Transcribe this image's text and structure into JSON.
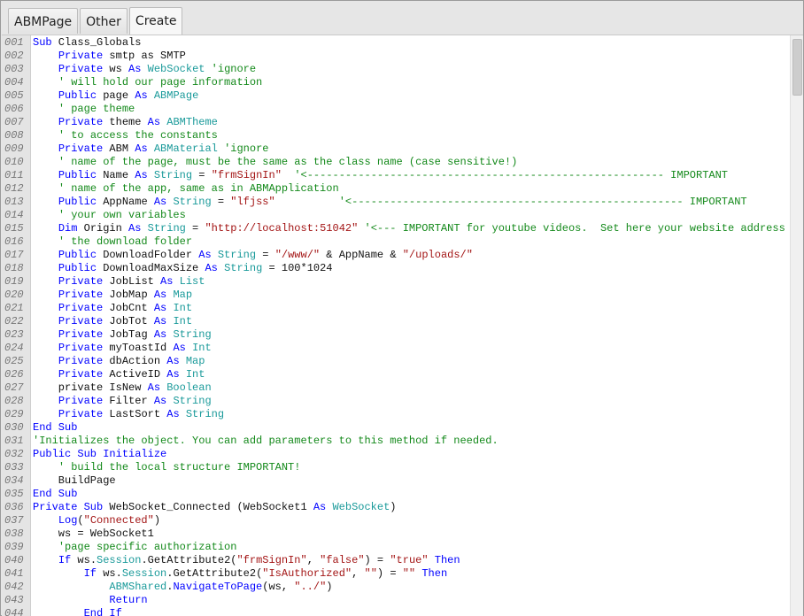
{
  "tabs": [
    {
      "label": "ABMPage"
    },
    {
      "label": "Other"
    },
    {
      "label": "Create",
      "active": true
    }
  ],
  "colors": {
    "keyword": "#0000ff",
    "type": "#1a9a9a",
    "string": "#a31515",
    "comment": "#13891a"
  },
  "lines": [
    [
      [
        "kw",
        "Sub"
      ],
      [
        "pl",
        " Class_Globals"
      ]
    ],
    [
      [
        "pl",
        "    "
      ],
      [
        "kw",
        "Private"
      ],
      [
        "pl",
        " smtp as SMTP"
      ]
    ],
    [
      [
        "pl",
        "    "
      ],
      [
        "kw",
        "Private"
      ],
      [
        "pl",
        " ws "
      ],
      [
        "kw",
        "As"
      ],
      [
        "pl",
        " "
      ],
      [
        "ty",
        "WebSocket"
      ],
      [
        "pl",
        " "
      ],
      [
        "cm",
        "'ignore"
      ]
    ],
    [
      [
        "pl",
        "    "
      ],
      [
        "cm",
        "' will hold our page information"
      ]
    ],
    [
      [
        "pl",
        "    "
      ],
      [
        "kw",
        "Public"
      ],
      [
        "pl",
        " page "
      ],
      [
        "kw",
        "As"
      ],
      [
        "pl",
        " "
      ],
      [
        "ty",
        "ABMPage"
      ]
    ],
    [
      [
        "pl",
        "    "
      ],
      [
        "cm",
        "' page theme"
      ]
    ],
    [
      [
        "pl",
        "    "
      ],
      [
        "kw",
        "Private"
      ],
      [
        "pl",
        " theme "
      ],
      [
        "kw",
        "As"
      ],
      [
        "pl",
        " "
      ],
      [
        "ty",
        "ABMTheme"
      ]
    ],
    [
      [
        "pl",
        "    "
      ],
      [
        "cm",
        "' to access the constants"
      ]
    ],
    [
      [
        "pl",
        "    "
      ],
      [
        "kw",
        "Private"
      ],
      [
        "pl",
        " ABM "
      ],
      [
        "kw",
        "As"
      ],
      [
        "pl",
        " "
      ],
      [
        "ty",
        "ABMaterial"
      ],
      [
        "pl",
        " "
      ],
      [
        "cm",
        "'ignore"
      ]
    ],
    [
      [
        "pl",
        "    "
      ],
      [
        "cm",
        "' name of the page, must be the same as the class name (case sensitive!)"
      ]
    ],
    [
      [
        "pl",
        "    "
      ],
      [
        "kw",
        "Public"
      ],
      [
        "pl",
        " Name "
      ],
      [
        "kw",
        "As"
      ],
      [
        "pl",
        " "
      ],
      [
        "ty",
        "String"
      ],
      [
        "pl",
        " = "
      ],
      [
        "st",
        "\"frmSignIn\""
      ],
      [
        "pl",
        "  "
      ],
      [
        "cm",
        "'<-------------------------------------------------------- IMPORTANT"
      ]
    ],
    [
      [
        "pl",
        "    "
      ],
      [
        "cm",
        "' name of the app, same as in ABMApplication"
      ]
    ],
    [
      [
        "pl",
        "    "
      ],
      [
        "kw",
        "Public"
      ],
      [
        "pl",
        " AppName "
      ],
      [
        "kw",
        "As"
      ],
      [
        "pl",
        " "
      ],
      [
        "ty",
        "String"
      ],
      [
        "pl",
        " = "
      ],
      [
        "st",
        "\"lfjss\""
      ],
      [
        "pl",
        "          "
      ],
      [
        "cm",
        "'<---------------------------------------------------- IMPORTANT"
      ]
    ],
    [
      [
        "pl",
        "    "
      ],
      [
        "cm",
        "' your own variables"
      ]
    ],
    [
      [
        "pl",
        "    "
      ],
      [
        "kw",
        "Dim"
      ],
      [
        "pl",
        " Origin "
      ],
      [
        "kw",
        "As"
      ],
      [
        "pl",
        " "
      ],
      [
        "ty",
        "String"
      ],
      [
        "pl",
        " = "
      ],
      [
        "st",
        "\"http://localhost:51042\""
      ],
      [
        "pl",
        " "
      ],
      [
        "cm",
        "'<--- IMPORTANT for youtube videos.  Set here your website address"
      ]
    ],
    [
      [
        "pl",
        "    "
      ],
      [
        "cm",
        "' the download folder"
      ]
    ],
    [
      [
        "pl",
        "    "
      ],
      [
        "kw",
        "Public"
      ],
      [
        "pl",
        " DownloadFolder "
      ],
      [
        "kw",
        "As"
      ],
      [
        "pl",
        " "
      ],
      [
        "ty",
        "String"
      ],
      [
        "pl",
        " = "
      ],
      [
        "st",
        "\"/www/\""
      ],
      [
        "pl",
        " & AppName & "
      ],
      [
        "st",
        "\"/uploads/\""
      ]
    ],
    [
      [
        "pl",
        "    "
      ],
      [
        "kw",
        "Public"
      ],
      [
        "pl",
        " DownloadMaxSize "
      ],
      [
        "kw",
        "As"
      ],
      [
        "pl",
        " "
      ],
      [
        "ty",
        "String"
      ],
      [
        "pl",
        " = 100*1024"
      ]
    ],
    [
      [
        "pl",
        "    "
      ],
      [
        "kw",
        "Private"
      ],
      [
        "pl",
        " JobList "
      ],
      [
        "kw",
        "As"
      ],
      [
        "pl",
        " "
      ],
      [
        "ty",
        "List"
      ]
    ],
    [
      [
        "pl",
        "    "
      ],
      [
        "kw",
        "Private"
      ],
      [
        "pl",
        " JobMap "
      ],
      [
        "kw",
        "As"
      ],
      [
        "pl",
        " "
      ],
      [
        "ty",
        "Map"
      ]
    ],
    [
      [
        "pl",
        "    "
      ],
      [
        "kw",
        "Private"
      ],
      [
        "pl",
        " JobCnt "
      ],
      [
        "kw",
        "As"
      ],
      [
        "pl",
        " "
      ],
      [
        "ty",
        "Int"
      ]
    ],
    [
      [
        "pl",
        "    "
      ],
      [
        "kw",
        "Private"
      ],
      [
        "pl",
        " JobTot "
      ],
      [
        "kw",
        "As"
      ],
      [
        "pl",
        " "
      ],
      [
        "ty",
        "Int"
      ]
    ],
    [
      [
        "pl",
        "    "
      ],
      [
        "kw",
        "Private"
      ],
      [
        "pl",
        " JobTag "
      ],
      [
        "kw",
        "As"
      ],
      [
        "pl",
        " "
      ],
      [
        "ty",
        "String"
      ]
    ],
    [
      [
        "pl",
        "    "
      ],
      [
        "kw",
        "Private"
      ],
      [
        "pl",
        " myToastId "
      ],
      [
        "kw",
        "As"
      ],
      [
        "pl",
        " "
      ],
      [
        "ty",
        "Int"
      ]
    ],
    [
      [
        "pl",
        "    "
      ],
      [
        "kw",
        "Private"
      ],
      [
        "pl",
        " dbAction "
      ],
      [
        "kw",
        "As"
      ],
      [
        "pl",
        " "
      ],
      [
        "ty",
        "Map"
      ]
    ],
    [
      [
        "pl",
        "    "
      ],
      [
        "kw",
        "Private"
      ],
      [
        "pl",
        " ActiveID "
      ],
      [
        "kw",
        "As"
      ],
      [
        "pl",
        " "
      ],
      [
        "ty",
        "Int"
      ]
    ],
    [
      [
        "pl",
        "    private IsNew "
      ],
      [
        "kw",
        "As"
      ],
      [
        "pl",
        " "
      ],
      [
        "ty",
        "Boolean"
      ]
    ],
    [
      [
        "pl",
        "    "
      ],
      [
        "kw",
        "Private"
      ],
      [
        "pl",
        " Filter "
      ],
      [
        "kw",
        "As"
      ],
      [
        "pl",
        " "
      ],
      [
        "ty",
        "String"
      ]
    ],
    [
      [
        "pl",
        "    "
      ],
      [
        "kw",
        "Private"
      ],
      [
        "pl",
        " LastSort "
      ],
      [
        "kw",
        "As"
      ],
      [
        "pl",
        " "
      ],
      [
        "ty",
        "String"
      ]
    ],
    [
      [
        "kw",
        "End Sub"
      ]
    ],
    [
      [
        "cm",
        "'Initializes the object. You can add parameters to this method if needed."
      ]
    ],
    [
      [
        "kw",
        "Public Sub Initialize"
      ]
    ],
    [
      [
        "pl",
        "    "
      ],
      [
        "cm",
        "' build the local structure IMPORTANT!"
      ]
    ],
    [
      [
        "pl",
        "    BuildPage"
      ]
    ],
    [
      [
        "kw",
        "End Sub"
      ]
    ],
    [
      [
        "kw",
        "Private Sub"
      ],
      [
        "pl",
        " WebSocket_Connected (WebSocket1 "
      ],
      [
        "kw",
        "As"
      ],
      [
        "pl",
        " "
      ],
      [
        "ty",
        "WebSocket"
      ],
      [
        "pl",
        ")"
      ]
    ],
    [
      [
        "pl",
        "    "
      ],
      [
        "kw",
        "Log"
      ],
      [
        "pl",
        "("
      ],
      [
        "st",
        "\"Connected\""
      ],
      [
        "pl",
        ")"
      ]
    ],
    [
      [
        "pl",
        "    ws = WebSocket1"
      ]
    ],
    [
      [
        "pl",
        "    "
      ],
      [
        "cm",
        "'page specific authorization"
      ]
    ],
    [
      [
        "pl",
        "    "
      ],
      [
        "kw",
        "If"
      ],
      [
        "pl",
        " ws."
      ],
      [
        "ty",
        "Session"
      ],
      [
        "pl",
        ".GetAttribute2("
      ],
      [
        "st",
        "\"frmSignIn\""
      ],
      [
        "pl",
        ", "
      ],
      [
        "st",
        "\"false\""
      ],
      [
        "pl",
        ") = "
      ],
      [
        "st",
        "\"true\""
      ],
      [
        "pl",
        " "
      ],
      [
        "kw",
        "Then"
      ]
    ],
    [
      [
        "pl",
        "        "
      ],
      [
        "kw",
        "If"
      ],
      [
        "pl",
        " ws."
      ],
      [
        "ty",
        "Session"
      ],
      [
        "pl",
        ".GetAttribute2("
      ],
      [
        "st",
        "\"IsAuthorized\""
      ],
      [
        "pl",
        ", "
      ],
      [
        "st",
        "\"\""
      ],
      [
        "pl",
        ") = "
      ],
      [
        "st",
        "\"\""
      ],
      [
        "pl",
        " "
      ],
      [
        "kw",
        "Then"
      ]
    ],
    [
      [
        "pl",
        "            "
      ],
      [
        "ty",
        "ABMShared"
      ],
      [
        "pl",
        "."
      ],
      [
        "kw",
        "NavigateToPage"
      ],
      [
        "pl",
        "(ws, "
      ],
      [
        "st",
        "\"../\""
      ],
      [
        "pl",
        ")"
      ]
    ],
    [
      [
        "pl",
        "            "
      ],
      [
        "kw",
        "Return"
      ]
    ],
    [
      [
        "pl",
        "        "
      ],
      [
        "kw",
        "End If"
      ]
    ]
  ]
}
